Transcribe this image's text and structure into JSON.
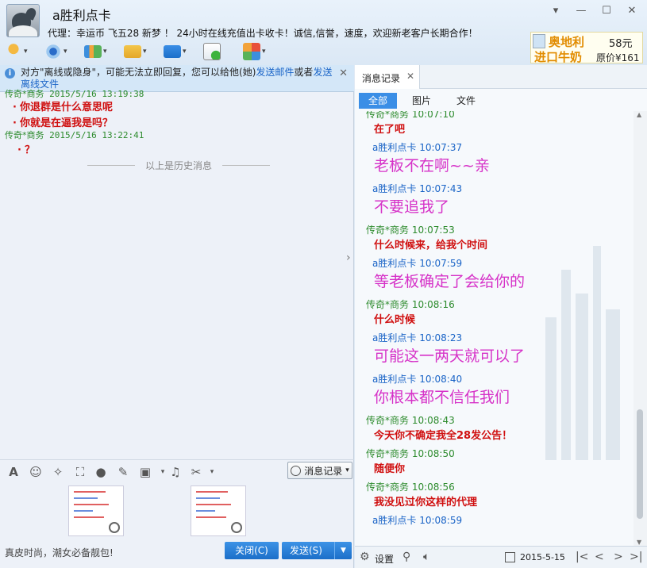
{
  "header": {
    "title": "a胜利点卡",
    "subtitle": "代理：幸运币   飞五28    新梦 ！ 24小时在线充值出卡收卡！诚信,信誉，速度，欢迎新老客户长期合作！",
    "ad": {
      "line1": "奥地利",
      "line2": "进口牛奶",
      "price": "58元",
      "original": "原价¥161"
    }
  },
  "toolbar_icons": [
    "microphone-icon",
    "camera-icon",
    "screen-share-icon",
    "file-transfer-icon",
    "remote-desktop-icon",
    "invite-chat-icon",
    "apps-icon"
  ],
  "notice": {
    "text": "对方\"离线或隐身\"，可能无法立即回复，您可以给他(她)",
    "link1": "发送邮件",
    "or": "或者",
    "link2": "发送离线文件"
  },
  "history": {
    "items": [
      {
        "sender": "传奇*商务",
        "time": "2015/5/16 13:19:38"
      },
      {
        "text": "你退群是什么意思呢"
      },
      {
        "text": "你就是在逼我是吗？"
      },
      {
        "sender": "传奇*商务",
        "time": "2015/5/16 13:22:41"
      },
      {
        "text": "？"
      }
    ],
    "divider": "以上是历史消息"
  },
  "history_button": "消息记录",
  "input_placeholder": "真皮时尚，潮女必备靓包!",
  "close_button": "关闭(C)",
  "send_button": "发送(S)",
  "right": {
    "tab": "消息记录",
    "filters": [
      "全部",
      "图片",
      "文件"
    ],
    "messages": [
      {
        "sender": "传奇*商务",
        "time": "10:07:10",
        "kind": "g"
      },
      {
        "text": "在了吧",
        "style": "bold"
      },
      {
        "sender": "a胜利点卡",
        "time": "10:07:37",
        "kind": "b"
      },
      {
        "text": "老板不在啊~~亲",
        "style": "big"
      },
      {
        "sender": "a胜利点卡",
        "time": "10:07:43",
        "kind": "b"
      },
      {
        "text": "不要追我了",
        "style": "big"
      },
      {
        "sender": "传奇*商务",
        "time": "10:07:53",
        "kind": "g"
      },
      {
        "text": "什么时候来，给我个时间",
        "style": "bold"
      },
      {
        "sender": "a胜利点卡",
        "time": "10:07:59",
        "kind": "b"
      },
      {
        "text": "等老板确定了会给你的",
        "style": "big"
      },
      {
        "sender": "传奇*商务",
        "time": "10:08:16",
        "kind": "g"
      },
      {
        "text": "什么时候",
        "style": "bold"
      },
      {
        "sender": "a胜利点卡",
        "time": "10:08:23",
        "kind": "b"
      },
      {
        "text": "可能这一两天就可以了",
        "style": "big"
      },
      {
        "sender": "a胜利点卡",
        "time": "10:08:40",
        "kind": "b"
      },
      {
        "text": "你根本都不信任我们",
        "style": "big"
      },
      {
        "sender": "传奇*商务",
        "time": "10:08:43",
        "kind": "g"
      },
      {
        "text": "今天你不确定我全28发公告！",
        "style": "bold"
      },
      {
        "sender": "传奇*商务",
        "time": "10:08:50",
        "kind": "g"
      },
      {
        "text": "随便你",
        "style": "bold"
      },
      {
        "sender": "传奇*商务",
        "time": "10:08:56",
        "kind": "g"
      },
      {
        "text": "我没见过你这样的代理",
        "style": "bold"
      },
      {
        "sender": "a胜利点卡",
        "time": "10:08:59",
        "kind": "b"
      }
    ],
    "footer": {
      "settings": "设置",
      "date": "2015-5-15"
    }
  }
}
